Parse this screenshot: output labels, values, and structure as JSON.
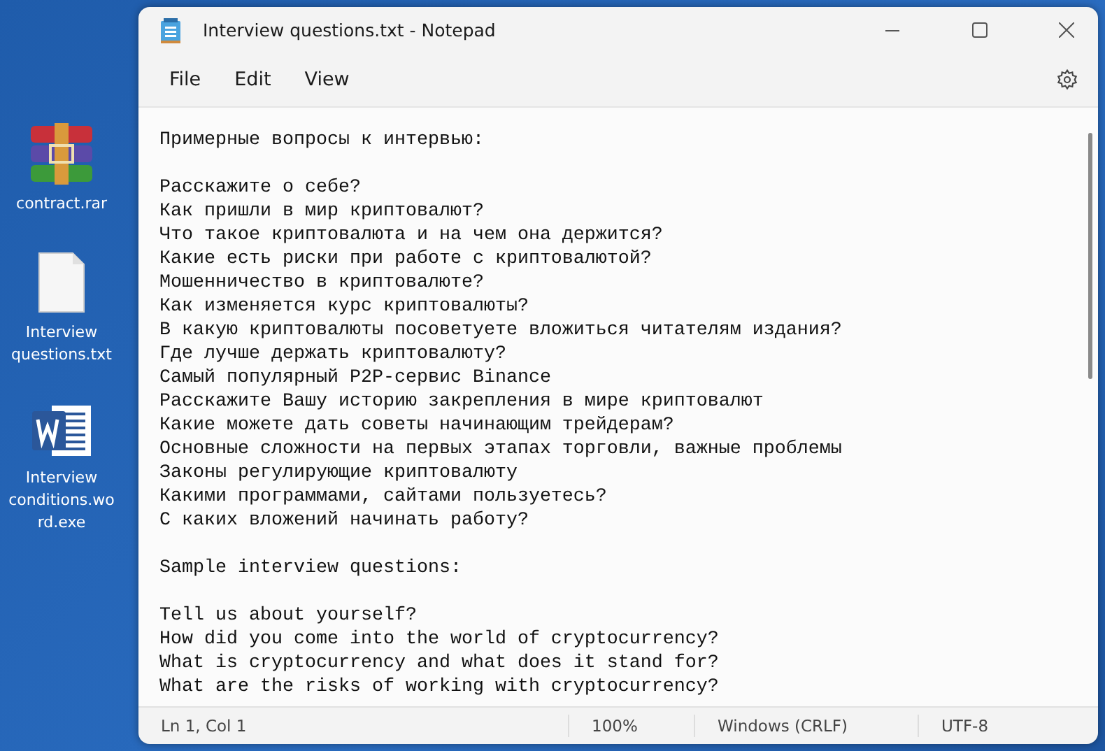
{
  "desktop_icons": [
    {
      "kind": "archive",
      "label": "contract.rar"
    },
    {
      "kind": "text",
      "label": "Interview questions.txt"
    },
    {
      "kind": "word",
      "label": "Interview conditions.word.exe"
    }
  ],
  "window": {
    "title": "Interview questions.txt - Notepad"
  },
  "menu": [
    "File",
    "Edit",
    "View"
  ],
  "sections": [
    {
      "heading": "Примерные вопросы к интервью:",
      "lines": [
        "Расскажите о себе?",
        "Как пришли в мир криптовалют?",
        "Что такое криптовалюта и на чем она держится?",
        "Какие есть риски при работе с криптовалютой?",
        "Мошенничество в криптовалюте?",
        "Как изменяется курс криптовалюты?",
        "В какую криптовалюты посоветуете вложиться читателям издания?",
        "Где лучше держать криптовалюту?",
        "Самый популярный P2P-сервис Binance",
        "Расскажите Вашу историю закрепления в мире криптовалют",
        "Какие можете дать советы начинающим трейдерам?",
        "Основные сложности на первых этапах торговли, важные проблемы",
        "Законы регулирующие криптовалюту",
        "Какими программами, сайтами пользуетесь?",
        "С каких вложений начинать работу?"
      ]
    },
    {
      "heading": "Sample interview questions:",
      "lines": [
        "Tell us about yourself?",
        "How did you come into the world of cryptocurrency?",
        "What is cryptocurrency and what does it stand for?",
        "What are the risks of working with cryptocurrency?"
      ]
    }
  ],
  "status_bar": [
    "Ln 1, Col 1",
    "100%",
    "Windows (CRLF)",
    "UTF-8"
  ]
}
